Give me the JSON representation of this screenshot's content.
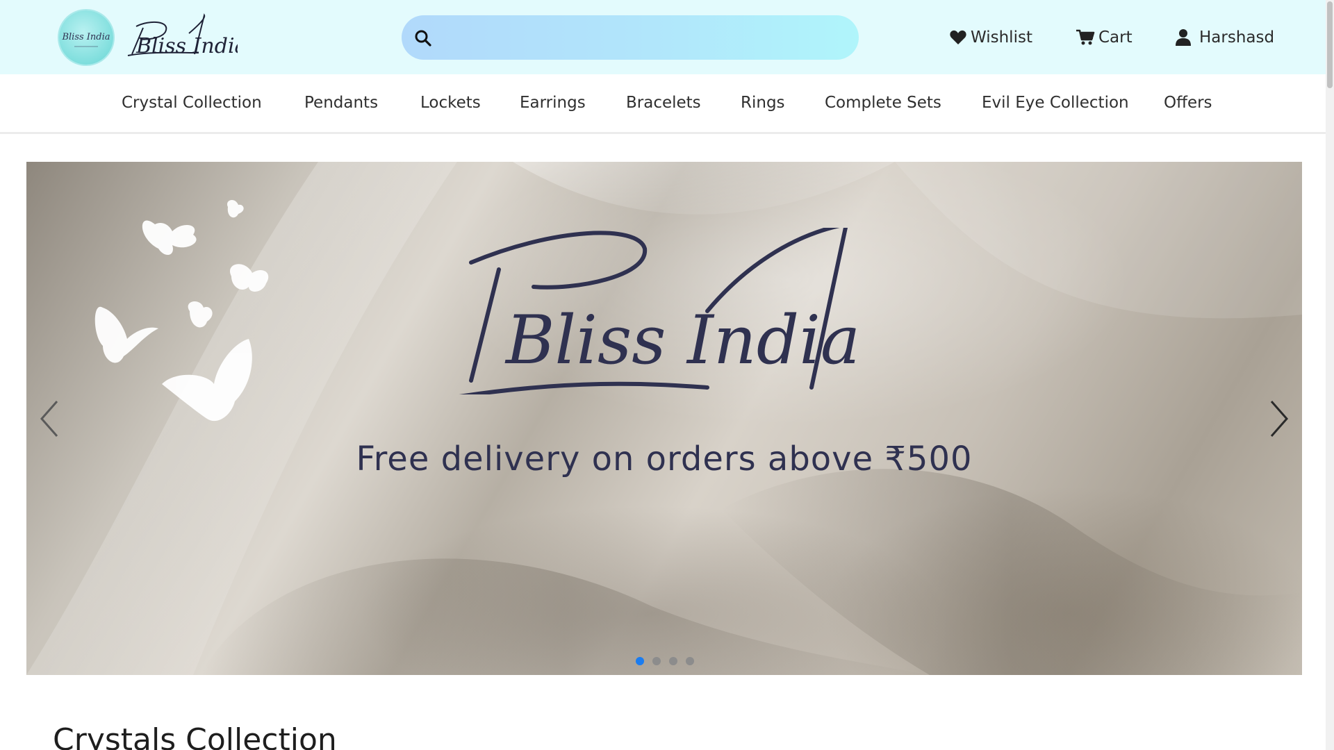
{
  "header": {
    "logo_badge_text": "Bliss India",
    "logo_text": "Bliss India",
    "search": {
      "placeholder": "",
      "value": ""
    },
    "wishlist_label": "Wishlist",
    "cart_label": "Cart",
    "user_label": "Harshasd"
  },
  "nav": {
    "items": [
      "Crystal Collection",
      "Pendants",
      "Lockets",
      "Earrings",
      "Bracelets",
      "Rings",
      "Complete Sets",
      "Evil Eye Collection",
      "Offers"
    ]
  },
  "carousel": {
    "brand_title": "Bliss India",
    "caption": "Free delivery on orders above ₹500",
    "slide_count": 4,
    "active_slide": 1
  },
  "section": {
    "title": "Crystals Collection"
  },
  "colors": {
    "header_bg": "#e3fbfd",
    "accent_dot": "#1a7cf0",
    "brand_navy": "#2f3150"
  },
  "icons": {
    "search": "search-icon",
    "wishlist": "heart-icon",
    "cart": "cart-icon",
    "user": "user-icon",
    "prev": "chevron-left-icon",
    "next": "chevron-right-icon"
  }
}
